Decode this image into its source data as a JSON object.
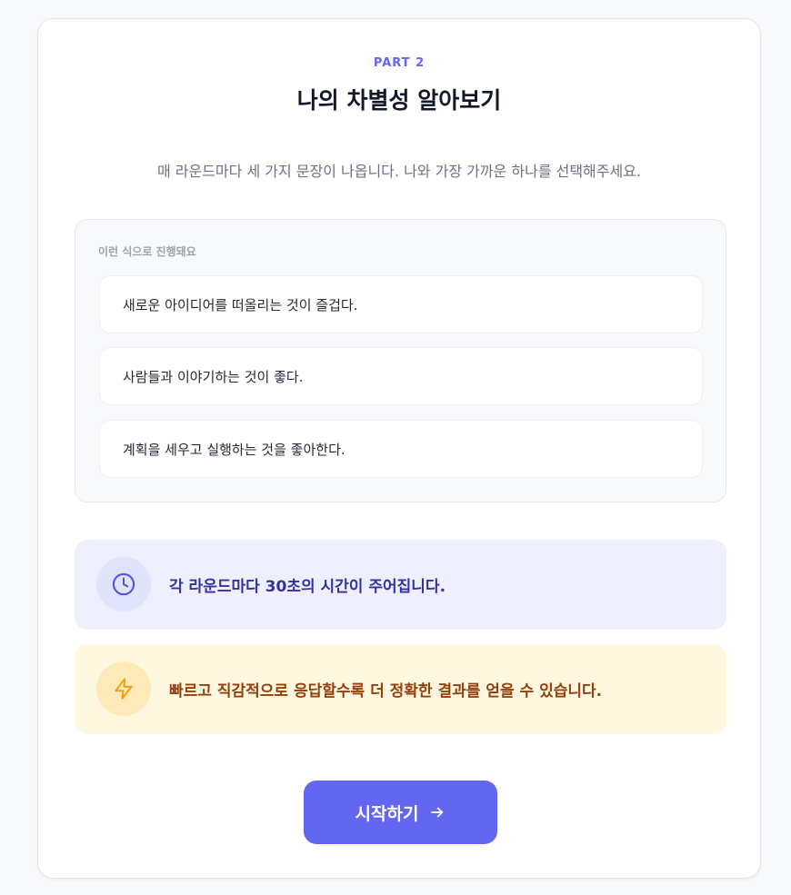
{
  "header": {
    "part_label": "PART 2",
    "title": "나의 차별성 알아보기",
    "subtitle": "매 라운드마다 세 가지 문장이 나옵니다. 나와 가장 가까운 하나를 선택해주세요."
  },
  "example": {
    "title": "이런 식으로 진행돼요",
    "options": [
      "새로운 아이디어를 떠올리는 것이 즐겁다.",
      "사람들과 이야기하는 것이 좋다.",
      "계획을 세우고 실행하는 것을 좋아한다."
    ]
  },
  "notices": {
    "time": {
      "icon": "clock-icon",
      "text": "각 라운드마다 30초의 시간이 주어집니다."
    },
    "speed": {
      "icon": "lightning-icon",
      "text": "빠르고 직감적으로 응답할수록 더 정확한 결과를 얻을 수 있습니다."
    }
  },
  "action": {
    "start_label": "시작하기",
    "icon": "arrow-right-icon"
  },
  "colors": {
    "accent": "#6366f1",
    "time_bg": "#eef0fd",
    "speed_bg": "#fff8e1",
    "time_text": "#3730a3",
    "speed_text": "#92400e"
  }
}
